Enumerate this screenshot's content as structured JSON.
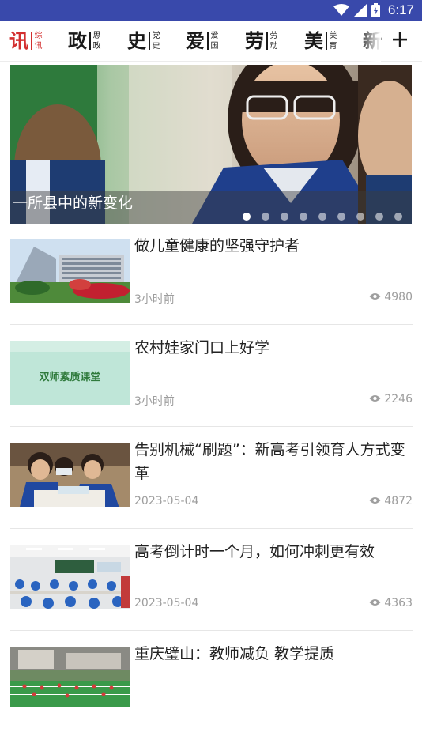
{
  "status_bar": {
    "time": "6:17",
    "icons": [
      "wifi-icon",
      "signal-icon",
      "battery-icon"
    ],
    "color": "#3949ab"
  },
  "channels": [
    {
      "big": "讯",
      "small_top": "综",
      "small_bottom": "讯",
      "active": true
    },
    {
      "big": "政",
      "small_top": "思",
      "small_bottom": "政",
      "active": false
    },
    {
      "big": "史",
      "small_top": "党",
      "small_bottom": "史",
      "active": false
    },
    {
      "big": "爱",
      "small_top": "爱",
      "small_bottom": "国",
      "active": false
    },
    {
      "big": "劳",
      "small_top": "劳",
      "small_bottom": "动",
      "active": false
    },
    {
      "big": "美",
      "small_top": "美",
      "small_bottom": "育",
      "active": false
    },
    {
      "big": "新",
      "small_top": "",
      "small_bottom": "",
      "active": false
    }
  ],
  "channel_add_icon": "plus-icon",
  "accent_color": "#d32f2f",
  "banner": {
    "title": "一所县中的新变化",
    "dot_count": 9,
    "active_dot": 0
  },
  "news": [
    {
      "title": "做儿童健康的坚强守护者",
      "time": "3小时前",
      "views": "4980",
      "thumb": "hospital-building-photo"
    },
    {
      "title": "农村娃家门口上好学",
      "time": "3小时前",
      "views": "2246",
      "thumb": "classroom-banner-image",
      "thumb_text": "双师素质课堂"
    },
    {
      "title": "告别机械“刷题”：新高考引领育人方式变革",
      "time": "2023-05-04",
      "views": "4872",
      "thumb": "students-studying-photo"
    },
    {
      "title": "高考倒计时一个月，如何冲刺更有效",
      "time": "2023-05-04",
      "views": "4363",
      "thumb": "classroom-photo"
    },
    {
      "title": "重庆璧山：教师减负 教学提质",
      "time": "",
      "views": "",
      "thumb": "sports-field-photo"
    }
  ],
  "views_icon": "eye-icon"
}
